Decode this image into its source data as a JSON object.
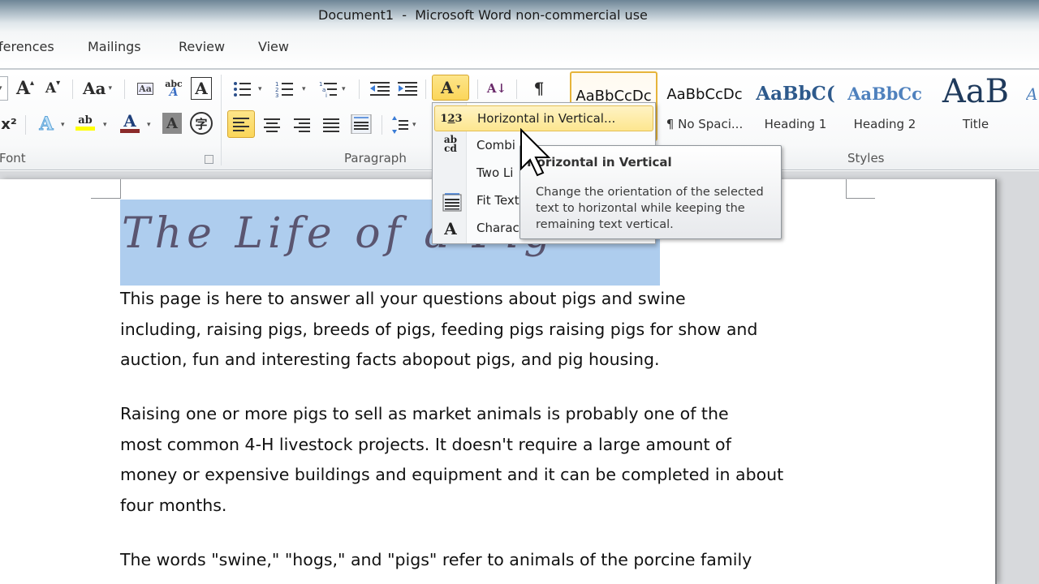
{
  "window": {
    "title": "Document1  -  Microsoft Word non-commercial use"
  },
  "tabs": [
    {
      "label": "ferences"
    },
    {
      "label": "Mailings"
    },
    {
      "label": "Review"
    },
    {
      "label": "View"
    }
  ],
  "ribbon": {
    "font_group": {
      "label": "Font",
      "buttons": {
        "grow_font": "A",
        "shrink_font": "A",
        "change_case": "Aa",
        "clear_formatting": "Aa",
        "phonetic_guide": "abc",
        "character_border": "A",
        "superscript": "x²",
        "text_effects": "A",
        "highlight": "ab",
        "font_color": "A",
        "character_shading": "A",
        "enclose_characters": "字"
      },
      "highlight_color": "#ffff00",
      "font_color_bar": "#8b2a2a"
    },
    "paragraph_group": {
      "label": "Paragraph",
      "buttons": {
        "bullets": "bullets-icon",
        "numbering": "numbering-icon",
        "multilevel": "multilevel-list-icon",
        "decrease_indent": "decrease-indent-icon",
        "increase_indent": "increase-indent-icon",
        "asian_layout": "A",
        "sort": "A↓",
        "show_marks": "¶",
        "align_left": "align-left-icon",
        "center": "center-icon",
        "align_right": "align-right-icon",
        "justify": "justify-icon",
        "distributed": "distributed-icon",
        "line_spacing": "line-spacing-icon"
      }
    },
    "styles_group": {
      "label": "Styles",
      "tiles": [
        {
          "sample": "AaBbCcDc",
          "name": ""
        },
        {
          "sample": "AaBbCcDc",
          "name": "¶ No Spaci..."
        },
        {
          "sample": "AaBbC(",
          "name": "Heading 1"
        },
        {
          "sample": "AaBbCc",
          "name": "Heading 2"
        },
        {
          "sample": "AaB",
          "name": "Title"
        },
        {
          "sample": "A",
          "name": ""
        }
      ]
    }
  },
  "menu": {
    "items": [
      {
        "icon": "1̣23",
        "label": "Horizontal in Vertical..."
      },
      {
        "icon": "ab/cd",
        "label": "Combine Characters..."
      },
      {
        "icon": "",
        "label": "Two Lines in One..."
      },
      {
        "icon": "fit",
        "label": "Fit Text..."
      },
      {
        "icon": "A",
        "label": "Character Scaling"
      }
    ],
    "visible_labels": [
      "Horizontal in Vertical...",
      "Combi",
      "Two Li",
      "Fit Text",
      "Charac"
    ]
  },
  "tooltip": {
    "title": "Horizontal in Vertical",
    "body": "Change the orientation of the selected text to horizontal while keeping the remaining text vertical."
  },
  "document": {
    "title": "The Life of a Pig",
    "title_visible": "The Life of a",
    "paragraphs": [
      {
        "lines": [
          "This page is here to answer all your questions about pigs and swine",
          "including, raising pigs, breeds of pigs, feeding pigs raising pigs for show and",
          "auction, fun and interesting facts abopout pigs, and pig housing."
        ]
      },
      {
        "lines": [
          "Raising one or more pigs to sell as market animals is probably one of the",
          "most common 4-H livestock projects.  It doesn't require a large amount of",
          "money or expensive buildings and equipment and it can be completed in about",
          "four months."
        ]
      },
      {
        "lines": [
          "The words \"swine,\" \"hogs,\" and \"pigs\" refer to animals of the porcine family"
        ]
      }
    ],
    "selection_color": "#aecdee"
  },
  "colors": {
    "accent_highlight": "#fde68f",
    "accent_border": "#e4bf55"
  }
}
